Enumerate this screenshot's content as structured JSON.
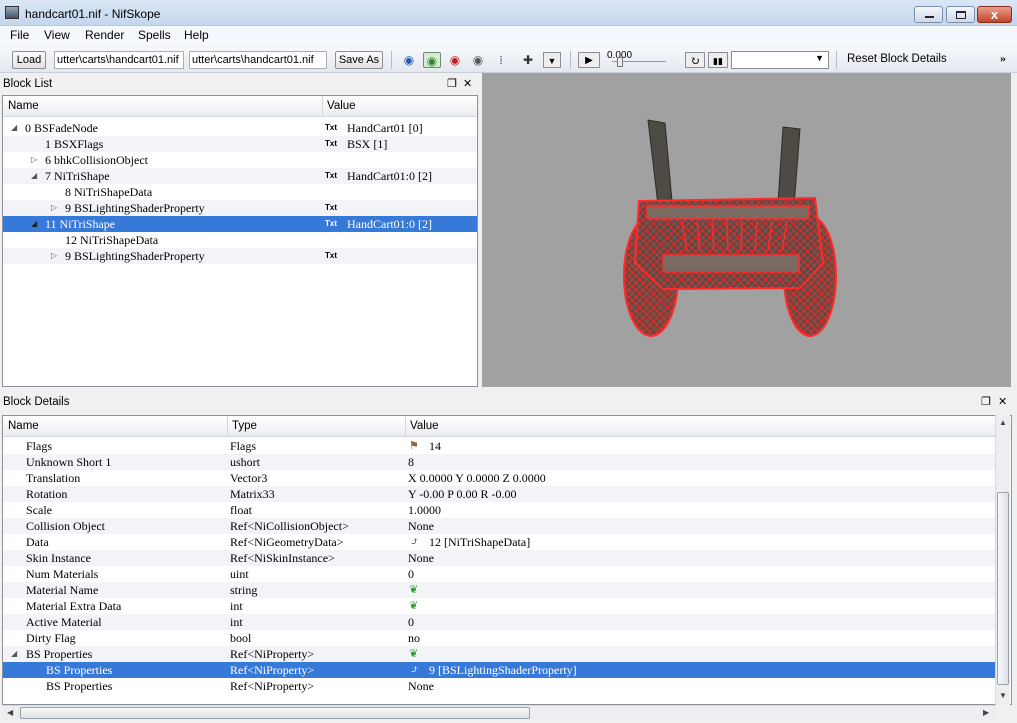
{
  "window": {
    "title": "handcart01.nif - NifSkope",
    "close_glyph": "x"
  },
  "menu": {
    "items": [
      "File",
      "View",
      "Render",
      "Spells",
      "Help"
    ]
  },
  "toolbar": {
    "load_label": "Load",
    "load_path": "utter\\carts\\handcart01.nif",
    "save_path": "utter\\carts\\handcart01.nif",
    "save_as_label": "Save As",
    "time_value": "0.000",
    "reset_label": "Reset Block Details",
    "overflow_glyph": "»"
  },
  "block_list": {
    "title": "Block List",
    "columns": {
      "name": "Name",
      "value": "Value"
    },
    "txt_badge": "Txt",
    "rows": [
      {
        "label": "0 BSFadeNode",
        "value": "HandCart01 [0]"
      },
      {
        "label": "1 BSXFlags",
        "value": "BSX [1]"
      },
      {
        "label": "6 bhkCollisionObject",
        "value": ""
      },
      {
        "label": "7 NiTriShape",
        "value": "HandCart01:0 [2]"
      },
      {
        "label": "8 NiTriShapeData",
        "value": ""
      },
      {
        "label": "9 BSLightingShaderProperty",
        "value": ""
      },
      {
        "label": "11 NiTriShape",
        "value": "HandCart01:0 [2]"
      },
      {
        "label": "12 NiTriShapeData",
        "value": ""
      },
      {
        "label": "9 BSLightingShaderProperty",
        "value": ""
      }
    ]
  },
  "block_details": {
    "title": "Block Details",
    "columns": {
      "name": "Name",
      "type": "Type",
      "value": "Value"
    },
    "rows": [
      {
        "name": "Flags",
        "type": "Flags",
        "value": "14"
      },
      {
        "name": "Unknown Short 1",
        "type": "ushort",
        "value": "8"
      },
      {
        "name": "Translation",
        "type": "Vector3",
        "value": "X 0.0000 Y 0.0000 Z 0.0000"
      },
      {
        "name": "Rotation",
        "type": "Matrix33",
        "value": "Y -0.00 P 0.00 R -0.00"
      },
      {
        "name": "Scale",
        "type": "float",
        "value": "1.0000"
      },
      {
        "name": "Collision Object",
        "type": "Ref<NiCollisionObject>",
        "value": "None"
      },
      {
        "name": "Data",
        "type": "Ref<NiGeometryData>",
        "value": "12 [NiTriShapeData]"
      },
      {
        "name": "Skin Instance",
        "type": "Ref<NiSkinInstance>",
        "value": "None"
      },
      {
        "name": "Num Materials",
        "type": "uint",
        "value": "0"
      },
      {
        "name": "Material Name",
        "type": "string",
        "value": ""
      },
      {
        "name": "Material Extra Data",
        "type": "int",
        "value": ""
      },
      {
        "name": "Active Material",
        "type": "int",
        "value": "0"
      },
      {
        "name": "Dirty Flag",
        "type": "bool",
        "value": "no"
      },
      {
        "name": "BS Properties",
        "type": "Ref<NiProperty>",
        "value": ""
      },
      {
        "name": "BS Properties",
        "type": "Ref<NiProperty>",
        "value": "9 [BSLightingShaderProperty]"
      },
      {
        "name": "BS Properties",
        "type": "Ref<NiProperty>",
        "value": "None"
      }
    ]
  },
  "colors": {
    "selection": "#3779d8",
    "viewport_bg": "#a1a1a1",
    "wireframe": "#ff2020"
  },
  "icons": {
    "flag": "flag-icon",
    "link": "link-icon",
    "array": "array-icon",
    "txt": "txt-icon"
  }
}
